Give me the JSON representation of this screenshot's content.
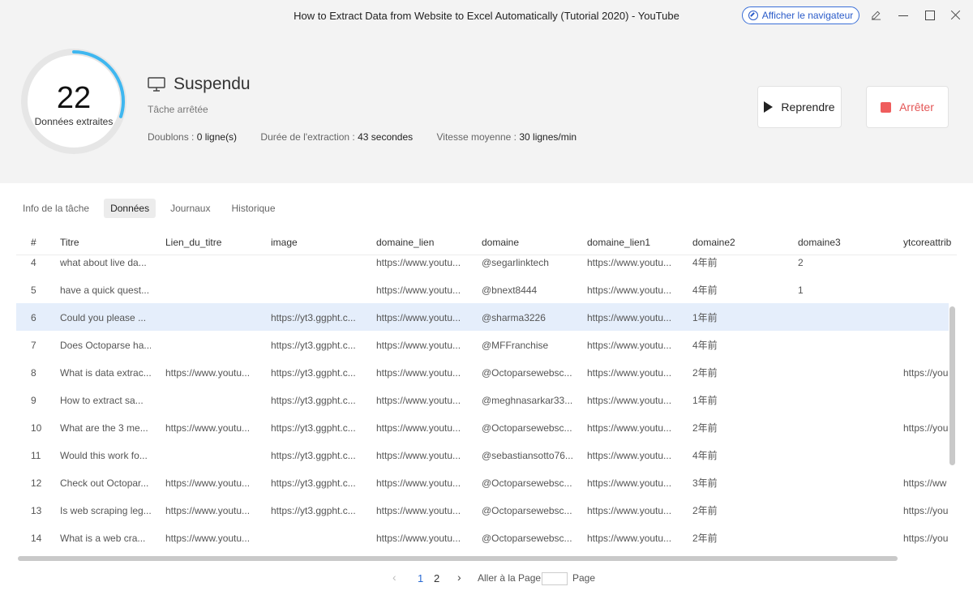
{
  "window": {
    "title": "How to Extract Data from Website to Excel Automatically (Tutorial 2020) - YouTube",
    "browser_button": "Afficher le navigateur"
  },
  "gauge": {
    "count": "22",
    "label": "Données extraites",
    "progress": 0.3
  },
  "status": {
    "title": "Suspendu",
    "subtitle": "Tâche arrêtée",
    "duplicates_label": "Doublons : ",
    "duplicates_value": "0 ligne(s)",
    "duration_label": "Durée de l'extraction : ",
    "duration_value": "43 secondes",
    "speed_label": "Vitesse moyenne : ",
    "speed_value": "30 lignes/min"
  },
  "actions": {
    "resume": "Reprendre",
    "stop": "Arrêter"
  },
  "tabs": [
    {
      "label": "Info de la tâche",
      "active": false
    },
    {
      "label": "Données",
      "active": true
    },
    {
      "label": "Journaux",
      "active": false
    },
    {
      "label": "Historique",
      "active": false
    }
  ],
  "table": {
    "columns": [
      "#",
      "Titre",
      "Lien_du_titre",
      "image",
      "domaine_lien",
      "domaine",
      "domaine_lien1",
      "domaine2",
      "domaine3",
      "ytcoreattribu"
    ],
    "rows": [
      [
        "4",
        "what about live da...",
        "",
        "",
        "https://www.youtu...",
        "@segarlinktech",
        "https://www.youtu...",
        "4年前",
        "2",
        ""
      ],
      [
        "5",
        "have a quick quest...",
        "",
        "",
        "https://www.youtu...",
        "@bnext8444",
        "https://www.youtu...",
        "4年前",
        "1",
        ""
      ],
      [
        "6",
        "Could you please ...",
        "",
        "https://yt3.ggpht.c...",
        "https://www.youtu...",
        "@sharma3226",
        "https://www.youtu...",
        "1年前",
        "",
        ""
      ],
      [
        "7",
        "Does Octoparse ha...",
        "",
        "https://yt3.ggpht.c...",
        "https://www.youtu...",
        "@MFFranchise",
        "https://www.youtu...",
        "4年前",
        "",
        ""
      ],
      [
        "8",
        "What is data extrac...",
        "https://www.youtu...",
        "https://yt3.ggpht.c...",
        "https://www.youtu...",
        "@Octoparsewebsc...",
        "https://www.youtu...",
        "2年前",
        "",
        "https://you"
      ],
      [
        "9",
        "How to extract sa...",
        "",
        "https://yt3.ggpht.c...",
        "https://www.youtu...",
        "@meghnasarkar33...",
        "https://www.youtu...",
        "1年前",
        "",
        ""
      ],
      [
        "10",
        "What are the 3 me...",
        "https://www.youtu...",
        "https://yt3.ggpht.c...",
        "https://www.youtu...",
        "@Octoparsewebsc...",
        "https://www.youtu...",
        "2年前",
        "",
        "https://you"
      ],
      [
        "11",
        "Would this work fo...",
        "",
        "https://yt3.ggpht.c...",
        "https://www.youtu...",
        "@sebastiansotto76...",
        "https://www.youtu...",
        "4年前",
        "",
        ""
      ],
      [
        "12",
        "Check out Octopar...",
        "https://www.youtu...",
        "https://yt3.ggpht.c...",
        "https://www.youtu...",
        "@Octoparsewebsc...",
        "https://www.youtu...",
        "3年前",
        "",
        "https://ww"
      ],
      [
        "13",
        "Is web scraping leg...",
        "https://www.youtu...",
        "https://yt3.ggpht.c...",
        "https://www.youtu...",
        "@Octoparsewebsc...",
        "https://www.youtu...",
        "2年前",
        "",
        "https://you"
      ],
      [
        "14",
        "What is a web cra...",
        "https://www.youtu...",
        "",
        "https://www.youtu...",
        "@Octoparsewebsc...",
        "https://www.youtu...",
        "2年前",
        "",
        "https://you"
      ]
    ],
    "selected_row": "6"
  },
  "pagination": {
    "prev": "‹",
    "pages": [
      "1",
      "2"
    ],
    "current": "1",
    "next": "›",
    "goto_label": "Aller à la Page",
    "page_label": "Page"
  },
  "colors": {
    "accent": "#2a6ad3",
    "stop": "#ef5d5d",
    "gauge": "#3fb7f0",
    "selected_row": "#e5eefb"
  }
}
